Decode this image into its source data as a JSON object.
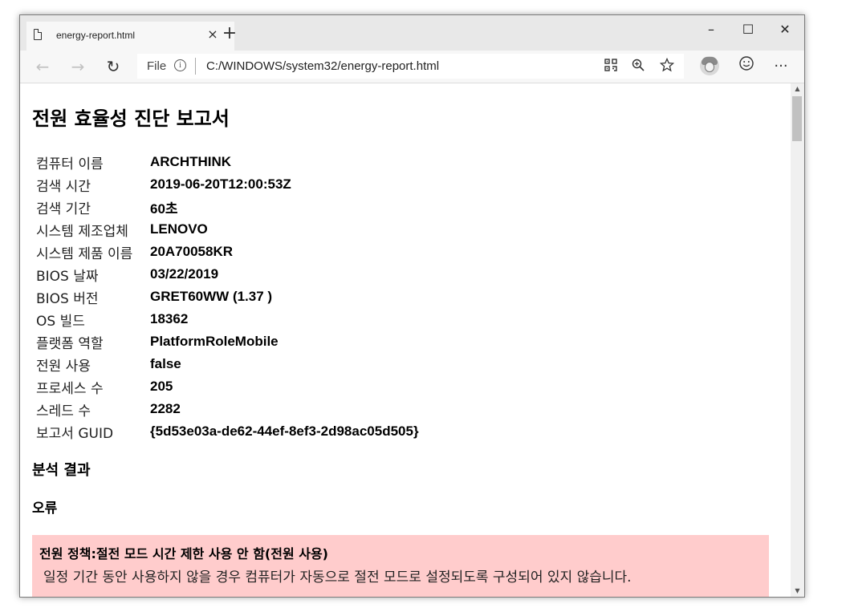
{
  "browser": {
    "tab_title": "energy-report.html",
    "tab_close_symbol": "×",
    "new_tab_symbol": "+",
    "window_controls": {
      "minimize": "–",
      "maximize": "☐",
      "close": "✕"
    },
    "nav": {
      "back": "←",
      "forward": "→",
      "refresh": "↻"
    },
    "address": {
      "scheme_label": "File",
      "info_icon": "i",
      "url": "C:/WINDOWS/system32/energy-report.html"
    },
    "icons": [
      "read-aloud-icon",
      "zoom-icon",
      "favorite-star-icon",
      "profile-avatar",
      "emoji-feedback-icon",
      "more-menu-icon"
    ],
    "more_symbol": "···"
  },
  "report": {
    "title": "전원 효율성 진단 보고서",
    "info_rows": [
      {
        "key": "컴퓨터 이름",
        "value": "ARCHTHINK"
      },
      {
        "key": "검색 시간",
        "value": "2019-06-20T12:00:53Z"
      },
      {
        "key": "검색 기간",
        "value": "60초"
      },
      {
        "key": "시스템 제조업체",
        "value": "LENOVO"
      },
      {
        "key": "시스템 제품 이름",
        "value": "20A70058KR"
      },
      {
        "key": "BIOS 날짜",
        "value": "03/22/2019"
      },
      {
        "key": "BIOS 버전",
        "value": "GRET60WW (1.37 )"
      },
      {
        "key": "OS 빌드",
        "value": "18362"
      },
      {
        "key": "플랫폼 역할",
        "value": "PlatformRoleMobile"
      },
      {
        "key": "전원 사용",
        "value": "false"
      },
      {
        "key": "프로세스 수",
        "value": "205"
      },
      {
        "key": "스레드 수",
        "value": "2282"
      },
      {
        "key": "보고서 GUID",
        "value": "{5d53e03a-de62-44ef-8ef3-2d98ac05d505}"
      }
    ],
    "analysis_heading": "분석 결과",
    "errors_heading": "오류",
    "error_item": {
      "title": "전원 정책:절전 모드 시간 제한 사용 안 함(전원 사용)",
      "description": "일정 기간 동안 사용하지 않을 경우 컴퓨터가 자동으로 절전 모드로 설정되도록 구성되어 있지 않습니다.",
      "background_color": "#ffcccc"
    }
  }
}
